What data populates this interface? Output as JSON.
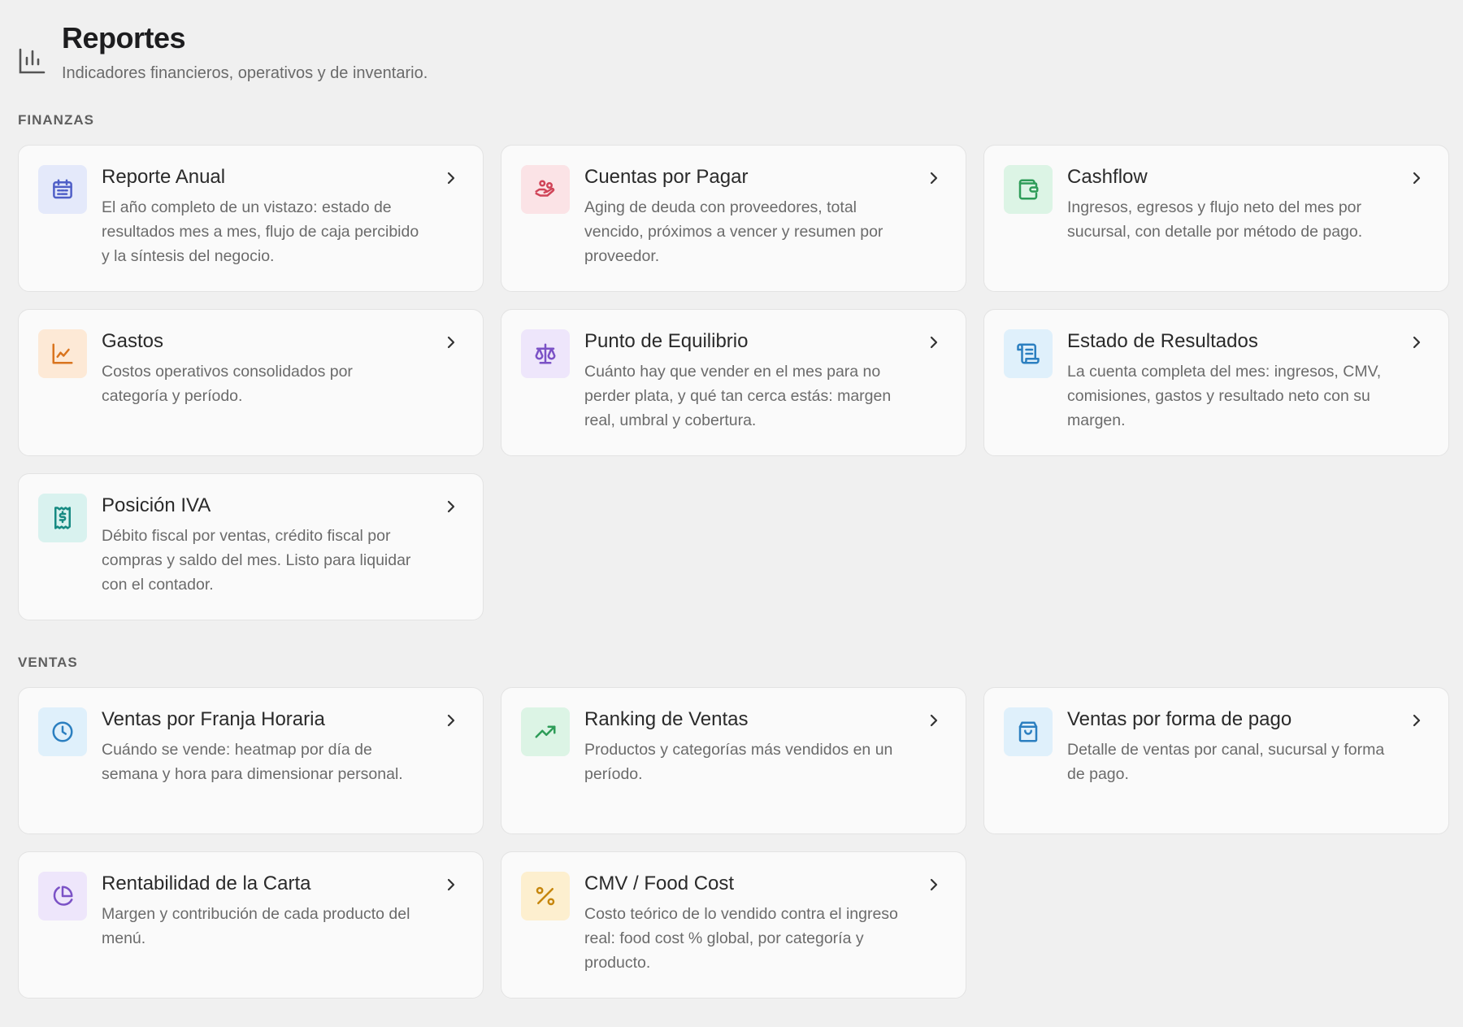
{
  "header": {
    "title": "Reportes",
    "subtitle": "Indicadores financieros, operativos y de inventario.",
    "icon": "bar-chart-icon"
  },
  "sections": [
    {
      "label": "FINANZAS",
      "cards": [
        {
          "title": "Reporte Anual",
          "description": "El año completo de un vistazo: estado de resultados mes a mes, flujo de caja percibido y la síntesis del negocio.",
          "icon": "calendar-icon",
          "color": "#4f5fc7"
        },
        {
          "title": "Cuentas por Pagar",
          "description": "Aging de deuda con proveedores, total vencido, próximos a vencer y resumen por proveedor.",
          "icon": "hand-coins-icon",
          "color": "#d04458"
        },
        {
          "title": "Cashflow",
          "description": "Ingresos, egresos y flujo neto del mes por sucursal, con detalle por método de pago.",
          "icon": "wallet-icon",
          "color": "#2e9c58"
        },
        {
          "title": "Gastos",
          "description": "Costos operativos consolidados por categoría y período.",
          "icon": "line-chart-icon",
          "color": "#d9741e"
        },
        {
          "title": "Punto de Equilibrio",
          "description": "Cuánto hay que vender en el mes para no perder plata, y qué tan cerca estás: margen real, umbral y cobertura.",
          "icon": "scale-icon",
          "color": "#7b52c6"
        },
        {
          "title": "Estado de Resultados",
          "description": "La cuenta completa del mes: ingresos, CMV, comisiones, gastos y resultado neto con su margen.",
          "icon": "scroll-icon",
          "color": "#2b7fc0"
        },
        {
          "title": "Posición IVA",
          "description": "Débito fiscal por ventas, crédito fiscal por compras y saldo del mes. Listo para liquidar con el contador.",
          "icon": "receipt-icon",
          "color": "#168a82"
        }
      ]
    },
    {
      "label": "VENTAS",
      "cards": [
        {
          "title": "Ventas por Franja Horaria",
          "description": "Cuándo se vende: heatmap por día de semana y hora para dimensionar personal.",
          "icon": "clock-icon",
          "color": "#2b7fc0"
        },
        {
          "title": "Ranking de Ventas",
          "description": "Productos y categorías más vendidos en un período.",
          "icon": "trending-up-icon",
          "color": "#2e9c58"
        },
        {
          "title": "Ventas por forma de pago",
          "description": "Detalle de ventas por canal, sucursal y forma de pago.",
          "icon": "shopping-bag-icon",
          "color": "#2b7fc0"
        },
        {
          "title": "Rentabilidad de la Carta",
          "description": "Margen y contribución de cada producto del menú.",
          "icon": "pie-chart-icon",
          "color": "#7b52c6"
        },
        {
          "title": "CMV / Food Cost",
          "description": "Costo teórico de lo vendido contra el ingreso real: food cost % global, por categoría y producto.",
          "icon": "percent-icon",
          "color": "#c6860d"
        }
      ]
    }
  ]
}
